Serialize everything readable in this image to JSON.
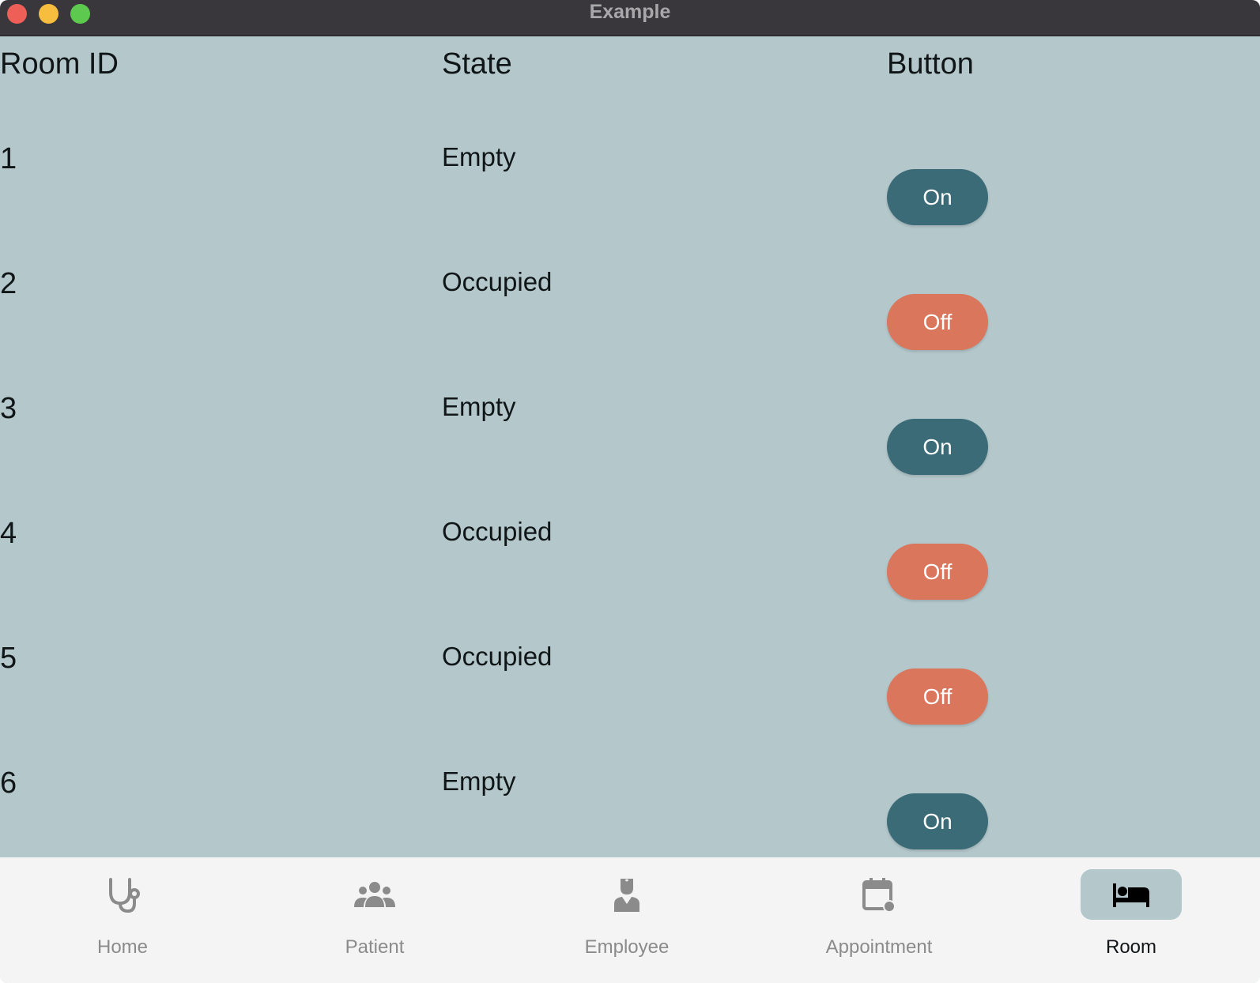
{
  "window": {
    "title": "Example"
  },
  "table": {
    "headers": {
      "room_id": "Room ID",
      "state": "State",
      "button": "Button"
    },
    "rows": [
      {
        "id": "1",
        "state": "Empty",
        "button": "On",
        "status": "on"
      },
      {
        "id": "2",
        "state": "Occupied",
        "button": "Off",
        "status": "off"
      },
      {
        "id": "3",
        "state": "Empty",
        "button": "On",
        "status": "on"
      },
      {
        "id": "4",
        "state": "Occupied",
        "button": "Off",
        "status": "off"
      },
      {
        "id": "5",
        "state": "Occupied",
        "button": "Off",
        "status": "off"
      },
      {
        "id": "6",
        "state": "Empty",
        "button": "On",
        "status": "on"
      }
    ]
  },
  "nav": {
    "items": [
      {
        "label": "Home",
        "icon": "stethoscope-icon",
        "active": false
      },
      {
        "label": "Patient",
        "icon": "people-icon",
        "active": false
      },
      {
        "label": "Employee",
        "icon": "doctor-icon",
        "active": false
      },
      {
        "label": "Appointment",
        "icon": "calendar-icon",
        "active": false
      },
      {
        "label": "Room",
        "icon": "bed-icon",
        "active": true
      }
    ]
  },
  "colors": {
    "background": "#b4c8cc",
    "on_button": "#3c6b78",
    "off_button": "#d9765b",
    "navbar": "#f4f4f4",
    "active_indicator": "#b4c8cc"
  }
}
